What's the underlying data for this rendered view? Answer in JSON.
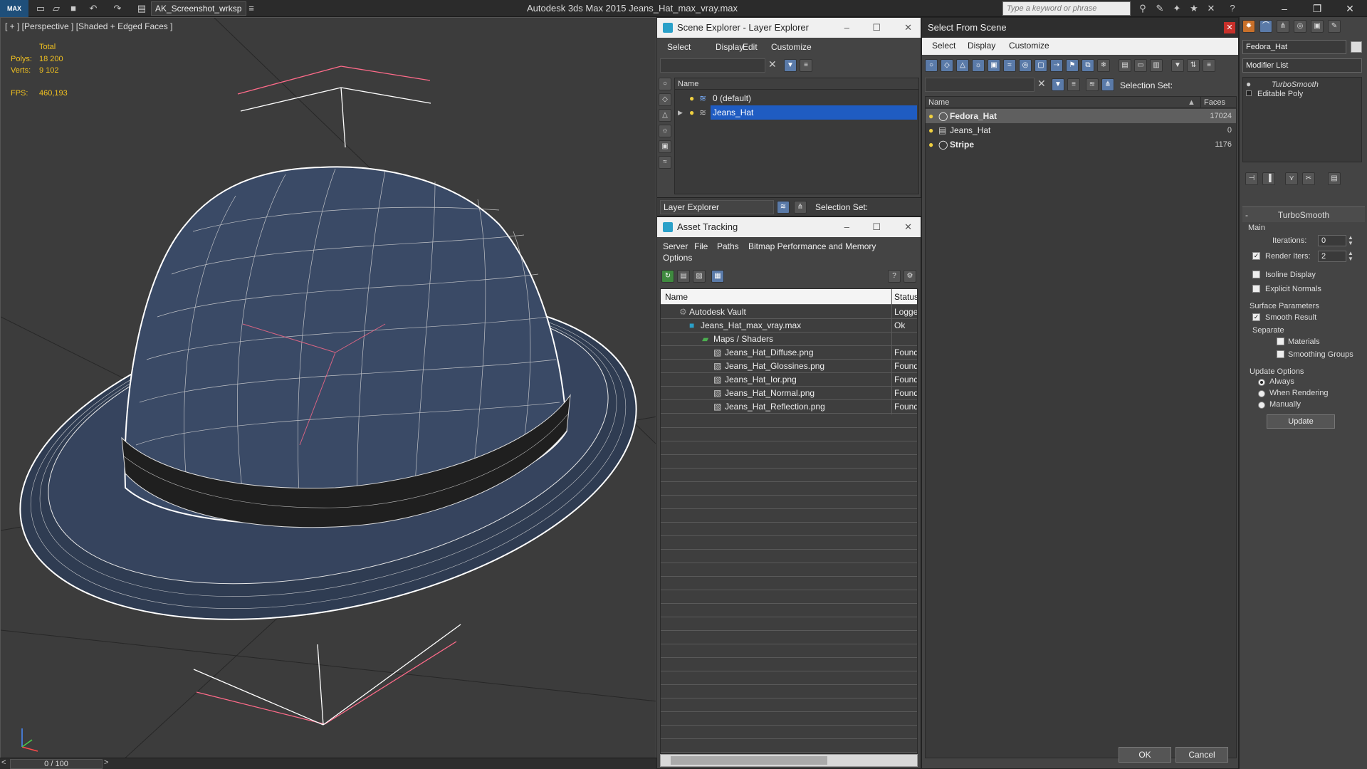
{
  "titlebar": {
    "logo": "MAX",
    "workspace": "AK_Screenshot_wrksp",
    "app_title": "Autodesk 3ds Max  2015    Jeans_Hat_max_vray.max",
    "search_placeholder": "Type a keyword or phrase"
  },
  "viewport": {
    "label": "[ + ] [Perspective ] [Shaded + Edged Faces ]",
    "stats": {
      "total_label": "Total",
      "polys_label": "Polys:",
      "polys_value": "18 200",
      "verts_label": "Verts:",
      "verts_value": "9 102",
      "fps_label": "FPS:",
      "fps_value": "460,193"
    }
  },
  "timeline": {
    "position": "0 / 100",
    "prev": "<",
    "next": ">"
  },
  "scene_explorer": {
    "title": "Scene Explorer - Layer Explorer",
    "menus": [
      "Select",
      "Display",
      "Edit",
      "Customize"
    ],
    "column_name": "Name",
    "rows": [
      "0 (default)",
      "Jeans_Hat"
    ],
    "footer_dropdown": "Layer Explorer",
    "selection_set_label": "Selection Set:"
  },
  "asset_tracking": {
    "title": "Asset Tracking",
    "menus": [
      "Server",
      "File",
      "Paths",
      "Bitmap Performance and Memory",
      "Options"
    ],
    "col_name": "Name",
    "col_status": "Status",
    "rows": [
      {
        "name": "Autodesk Vault",
        "status": "Logged"
      },
      {
        "name": "Jeans_Hat_max_vray.max",
        "status": "Ok"
      },
      {
        "name": "Maps / Shaders",
        "status": ""
      },
      {
        "name": "Jeans_Hat_Diffuse.png",
        "status": "Found"
      },
      {
        "name": "Jeans_Hat_Glossines.png",
        "status": "Found"
      },
      {
        "name": "Jeans_Hat_Ior.png",
        "status": "Found"
      },
      {
        "name": "Jeans_Hat_Normal.png",
        "status": "Found"
      },
      {
        "name": "Jeans_Hat_Reflection.png",
        "status": "Found"
      }
    ]
  },
  "select_from_scene": {
    "title": "Select From Scene",
    "menus": [
      "Select",
      "Display",
      "Customize"
    ],
    "selection_set_label": "Selection Set:",
    "col_name": "Name",
    "col_faces": "Faces",
    "rows": [
      {
        "name": "Fedora_Hat",
        "faces": "17024"
      },
      {
        "name": "Jeans_Hat",
        "faces": "0"
      },
      {
        "name": "Stripe",
        "faces": "1176"
      }
    ],
    "ok_label": "OK",
    "cancel_label": "Cancel"
  },
  "command_panel": {
    "object_name": "Fedora_Hat",
    "modifier_list": "Modifier List",
    "stack": [
      "TurboSmooth",
      "Editable Poly"
    ],
    "rollout_title": "TurboSmooth",
    "main_group": "Main",
    "iterations_label": "Iterations:",
    "iterations_value": "0",
    "render_iters_label": "Render Iters:",
    "render_iters_value": "2",
    "isoline_label": "Isoline Display",
    "explicit_normals_label": "Explicit Normals",
    "surface_group": "Surface Parameters",
    "smooth_result_label": "Smooth Result",
    "separate_label": "Separate",
    "materials_label": "Materials",
    "smoothing_groups_label": "Smoothing Groups",
    "update_group": "Update Options",
    "always_label": "Always",
    "when_rendering_label": "When Rendering",
    "manually_label": "Manually",
    "update_button": "Update"
  }
}
